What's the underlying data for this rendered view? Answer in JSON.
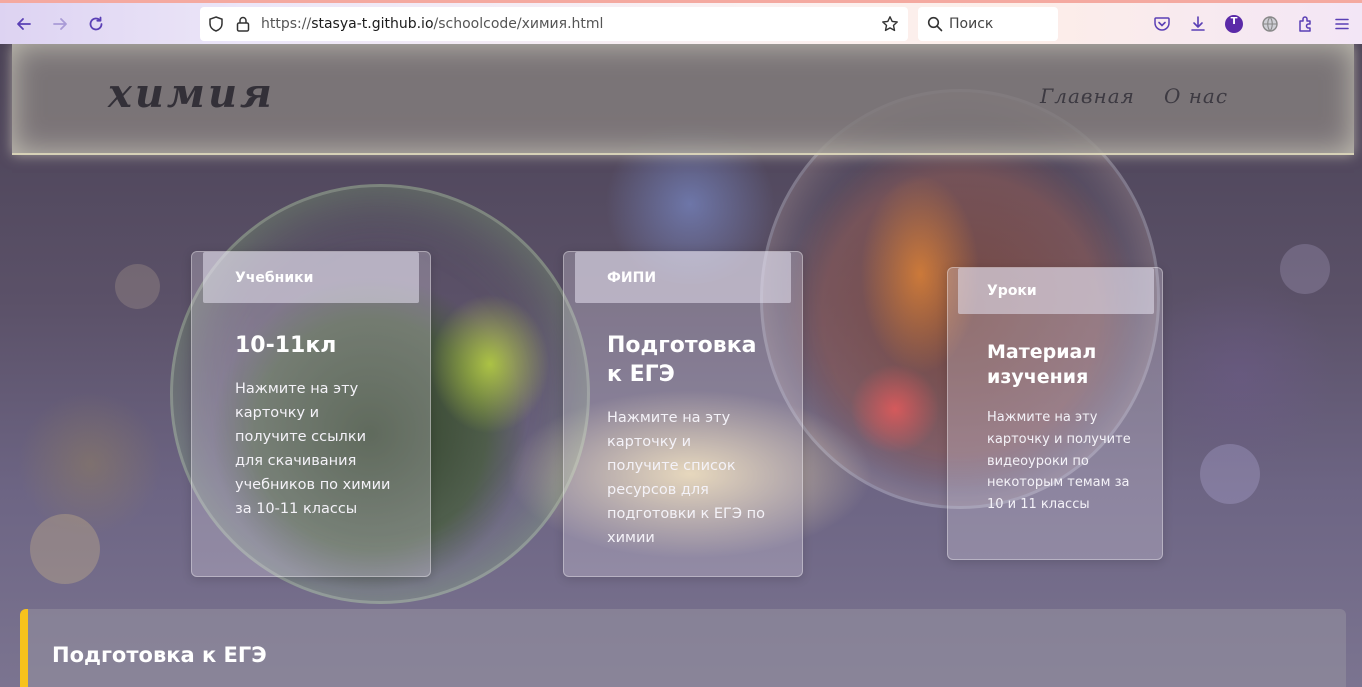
{
  "browser": {
    "url_prefix": "https://",
    "url_host": "stasya-t.github.io",
    "url_path": "/schoolcode/химия.html",
    "search_placeholder": "Поиск",
    "profile_initial": "T"
  },
  "header": {
    "logo": "химия",
    "nav": [
      "Главная",
      "О нас"
    ]
  },
  "cards": [
    {
      "tab": "Учебники",
      "title": "10-11кл",
      "description": "Нажмите на эту карточку и получите ссылки для скачивания учебников по химии за 10-11 классы"
    },
    {
      "tab": "ФИПИ",
      "title": "Подготовка к ЕГЭ",
      "description": "Нажмите на эту карточку и получите список ресурсов для подготовки к ЕГЭ по химии"
    },
    {
      "tab": "Уроки",
      "title": "Материал изучения",
      "description": "Нажмите на эту карточку и получите видеоуроки по некоторым темам за 10 и 11 классы"
    }
  ],
  "section": {
    "title": "Подготовка к ЕГЭ"
  },
  "colors": {
    "accent": "#f6c21c",
    "profile": "#5b2aa8"
  }
}
